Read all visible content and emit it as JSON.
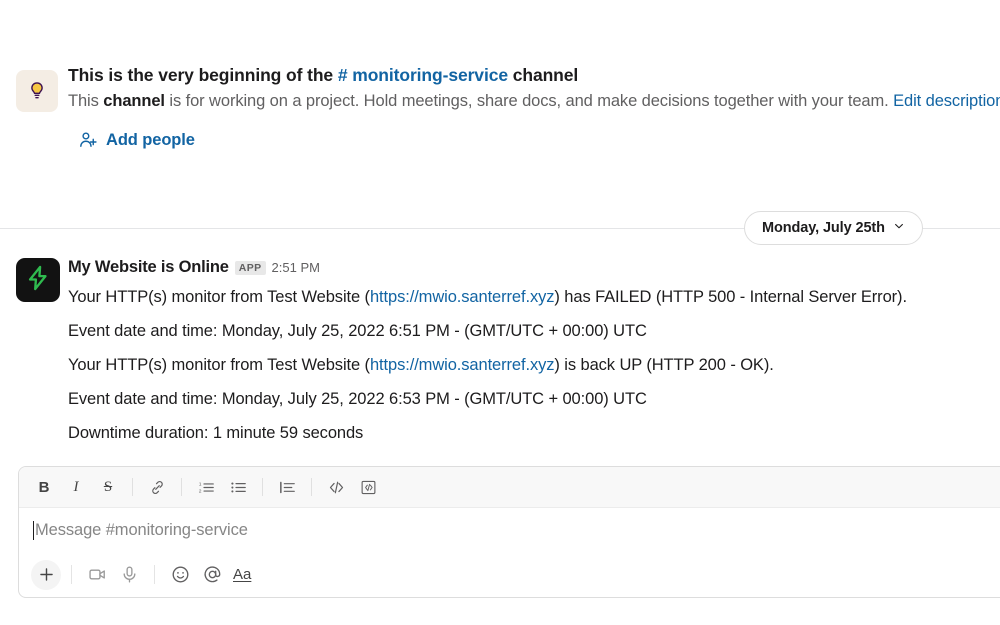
{
  "channel_intro": {
    "icon": "lightbulb-icon",
    "title_prefix": "This is the very beginning of the ",
    "channel_hash": "# ",
    "channel_name": "monitoring-service",
    "title_suffix": " channel",
    "description_part1": "This ",
    "description_bold": "channel",
    "description_part2": " is for working on a project. Hold meetings, share docs, and make decisions together with your team. ",
    "edit_link": "Edit description",
    "add_people_label": "Add people",
    "add_people_icon": "person-plus-icon"
  },
  "date_divider": {
    "label": "Monday, July 25th",
    "chevron_icon": "chevron-down-icon"
  },
  "message": {
    "avatar_icon": "lightning-bolt-icon",
    "author": "My Website is Online",
    "badge": "APP",
    "time": "2:51 PM",
    "lines": [
      {
        "before_link": "Your HTTP(s) monitor from Test Website (",
        "link": "https://mwio.santerref.xyz",
        "after_link": ") has FAILED (HTTP 500 - Internal Server Error)."
      },
      {
        "text": "Event date and time: Monday, July 25, 2022 6:51 PM - (GMT/UTC + 00:00) UTC"
      },
      {
        "before_link": "Your HTTP(s) monitor from Test Website (",
        "link": "https://mwio.santerref.xyz",
        "after_link": ") is back UP (HTTP 200 - OK)."
      },
      {
        "text": "Event date and time: Monday, July 25, 2022 6:53 PM - (GMT/UTC + 00:00) UTC"
      },
      {
        "text": "Downtime duration: 1 minute 59 seconds"
      }
    ]
  },
  "composer": {
    "placeholder": "Message #monitoring-service",
    "format_buttons": [
      {
        "name": "bold-icon",
        "label": "B"
      },
      {
        "name": "italic-icon",
        "label": "I"
      },
      {
        "name": "strikethrough-icon",
        "label": "S"
      },
      {
        "name": "link-icon",
        "label": ""
      },
      {
        "name": "ordered-list-icon",
        "label": ""
      },
      {
        "name": "bulleted-list-icon",
        "label": ""
      },
      {
        "name": "blockquote-icon",
        "label": ""
      },
      {
        "name": "code-icon",
        "label": ""
      },
      {
        "name": "code-block-icon",
        "label": ""
      }
    ],
    "action_buttons": [
      {
        "name": "plus-icon"
      },
      {
        "name": "video-icon"
      },
      {
        "name": "microphone-icon"
      },
      {
        "name": "emoji-icon"
      },
      {
        "name": "mention-icon"
      },
      {
        "name": "formatting-icon",
        "label": "Aa"
      }
    ]
  },
  "colors": {
    "link_blue": "#1264a3",
    "text_primary": "#1d1c1d",
    "text_secondary": "#616061",
    "avatar_bg": "#121212",
    "bolt_green": "#2fbb4f",
    "bulb_tile_bg": "#f4ede4",
    "bulb_yellow": "#f6c744",
    "toolbar_bg": "#f8f8f8",
    "border": "#dddddd"
  }
}
